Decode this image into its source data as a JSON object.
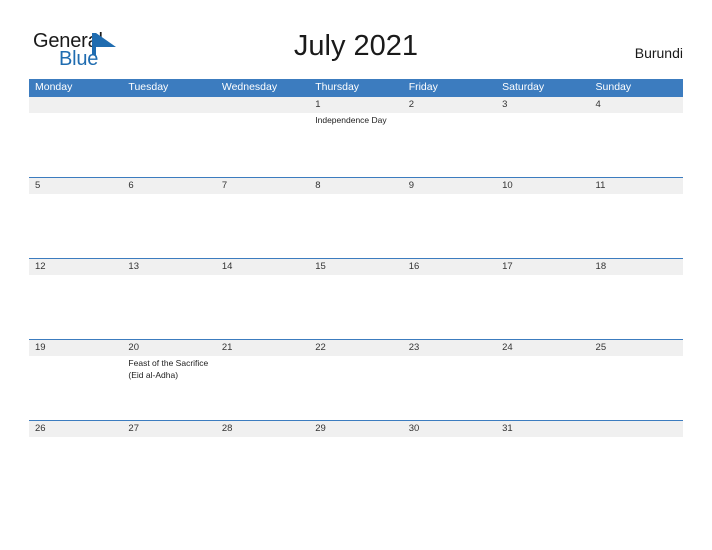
{
  "brand": {
    "name_part1": "General",
    "name_part2": "Blue",
    "flag_icon": "blue-flag-triangle",
    "color_dark": "#1a1a1a",
    "color_blue": "#1f6cb0"
  },
  "header": {
    "title": "July 2021",
    "country": "Burundi"
  },
  "theme": {
    "header_blue": "#3c7cbf",
    "band_gray": "#f0f0f0",
    "background": "#ffffff",
    "text": "#1a1a1a"
  },
  "weekdays": [
    "Monday",
    "Tuesday",
    "Wednesday",
    "Thursday",
    "Friday",
    "Saturday",
    "Sunday"
  ],
  "weeks": [
    {
      "days": [
        {
          "num": "",
          "events": []
        },
        {
          "num": "",
          "events": []
        },
        {
          "num": "",
          "events": []
        },
        {
          "num": "1",
          "events": [
            "Independence Day"
          ]
        },
        {
          "num": "2",
          "events": []
        },
        {
          "num": "3",
          "events": []
        },
        {
          "num": "4",
          "events": []
        }
      ]
    },
    {
      "days": [
        {
          "num": "5",
          "events": []
        },
        {
          "num": "6",
          "events": []
        },
        {
          "num": "7",
          "events": []
        },
        {
          "num": "8",
          "events": []
        },
        {
          "num": "9",
          "events": []
        },
        {
          "num": "10",
          "events": []
        },
        {
          "num": "11",
          "events": []
        }
      ]
    },
    {
      "days": [
        {
          "num": "12",
          "events": []
        },
        {
          "num": "13",
          "events": []
        },
        {
          "num": "14",
          "events": []
        },
        {
          "num": "15",
          "events": []
        },
        {
          "num": "16",
          "events": []
        },
        {
          "num": "17",
          "events": []
        },
        {
          "num": "18",
          "events": []
        }
      ]
    },
    {
      "days": [
        {
          "num": "19",
          "events": []
        },
        {
          "num": "20",
          "events": [
            "Feast of the Sacrifice (Eid al-Adha)"
          ]
        },
        {
          "num": "21",
          "events": []
        },
        {
          "num": "22",
          "events": []
        },
        {
          "num": "23",
          "events": []
        },
        {
          "num": "24",
          "events": []
        },
        {
          "num": "25",
          "events": []
        }
      ]
    },
    {
      "days": [
        {
          "num": "26",
          "events": []
        },
        {
          "num": "27",
          "events": []
        },
        {
          "num": "28",
          "events": []
        },
        {
          "num": "29",
          "events": []
        },
        {
          "num": "30",
          "events": []
        },
        {
          "num": "31",
          "events": []
        },
        {
          "num": "",
          "events": []
        }
      ]
    }
  ]
}
